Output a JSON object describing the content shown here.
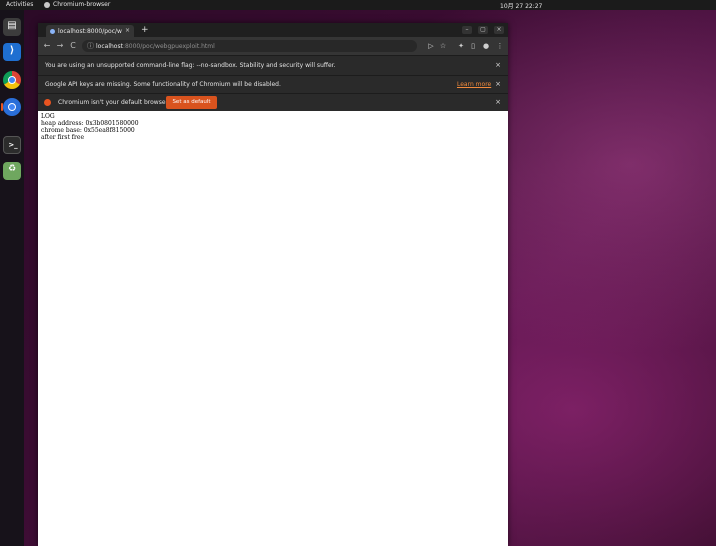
{
  "topbar": {
    "activities": "Activities",
    "app_name": "Chromium-browser",
    "clock": "10月 27  22:27"
  },
  "dock": {
    "items": [
      {
        "icon": "files-icon"
      },
      {
        "icon": "vscode-icon"
      },
      {
        "icon": "chrome-icon"
      },
      {
        "icon": "chromium-icon"
      },
      {
        "icon": "terminal-icon"
      },
      {
        "icon": "trash-icon"
      }
    ]
  },
  "browser": {
    "tab_title": "localhost:8000/poc/we...",
    "tab_close": "×",
    "new_tab": "+",
    "window_controls": {
      "minimize": "–",
      "maximize": "▢",
      "close": "×"
    },
    "nav": {
      "back": "←",
      "forward": "→",
      "reload": "C"
    },
    "url_host": "localhost",
    "url_path": ":8000/poc/webgpuexploit.html",
    "infobars": {
      "sandbox_warning": "You are using an unsupported command-line flag: --no-sandbox. Stability and security will suffer.",
      "api_keys_warning": "Google API keys are missing. Some functionality of Chromium will be disabled.",
      "learn_more": "Learn more",
      "default_browser": "Chromium isn't your default browser",
      "set_default": "Set as default",
      "close": "×"
    }
  },
  "page": {
    "lines": [
      "LOG",
      "heap address: 0x3b0801580000",
      "chrome base: 0x55ea8f815000",
      "after first free"
    ]
  },
  "colors": {
    "accent": "#e95420",
    "infobar_bg": "#2a2a2a",
    "toolbar_bg": "#353535"
  }
}
